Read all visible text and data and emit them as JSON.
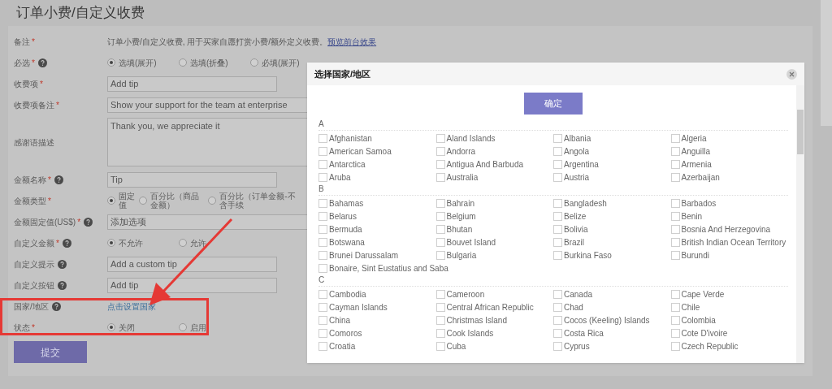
{
  "page": {
    "title": "订单小费/自定义收费"
  },
  "form": {
    "rows": [
      {
        "kind": "note",
        "label": "备注",
        "required_mark": "*",
        "help": false,
        "text": "订单小费/自定义收费, 用于买家自愿打赏小费/额外定义收费。",
        "link": "预览前台效果"
      },
      {
        "kind": "radio",
        "label": "必选",
        "required_mark": "*",
        "help": true,
        "options": [
          {
            "label": "选填(展开)",
            "selected": true
          },
          {
            "label": "选填(折叠)",
            "selected": false
          },
          {
            "label": "必填(展开)",
            "selected": false
          }
        ]
      },
      {
        "kind": "input",
        "label": "收费项",
        "required_mark": "*",
        "help": false,
        "value": "Add tip"
      },
      {
        "kind": "wide_input",
        "label": "收费项备注",
        "required_mark": "*",
        "help": false,
        "value": "Show your support for the team at enterprise"
      },
      {
        "kind": "textarea",
        "label": "感谢语描述",
        "help": false,
        "value": "Thank you, we appreciate it"
      },
      {
        "kind": "input",
        "label": "金额名称",
        "required_mark": "*",
        "help": true,
        "value": "Tip"
      },
      {
        "kind": "radio_tight",
        "label": "金额类型",
        "required_mark": "*",
        "help": false,
        "options": [
          {
            "label": "固定值",
            "selected": true
          },
          {
            "label": "百分比（商品金额）",
            "selected": false
          },
          {
            "label": "百分比（订单金额-不含手续",
            "selected": false
          }
        ]
      },
      {
        "kind": "wide_input",
        "label": "金额固定值(US$)",
        "required_mark": "*",
        "help": true,
        "value": "添加选项"
      },
      {
        "kind": "radio",
        "label": "自定义金额",
        "required_mark": "*",
        "help": true,
        "options": [
          {
            "label": "不允许",
            "selected": true
          },
          {
            "label": "允许",
            "selected": false
          }
        ]
      },
      {
        "kind": "input",
        "label": "自定义提示",
        "help": true,
        "value": "Add a custom tip"
      },
      {
        "kind": "input",
        "label": "自定义按钮",
        "help": true,
        "value": "Add tip"
      },
      {
        "kind": "link",
        "label": "国家/地区",
        "help": true,
        "link": "点击设置国家"
      },
      {
        "kind": "radio",
        "label": "状态",
        "required_mark": "*",
        "help": false,
        "options": [
          {
            "label": "关闭",
            "selected": true
          },
          {
            "label": "启用",
            "selected": false
          }
        ]
      }
    ],
    "submit": "提交"
  },
  "dialog": {
    "title": "选择国家/地区",
    "confirm": "确定",
    "sections": [
      {
        "letter": "A",
        "countries": [
          {
            "name": "Afghanistan",
            "checked": false
          },
          {
            "name": "Aland Islands",
            "checked": false
          },
          {
            "name": "Albania",
            "checked": false
          },
          {
            "name": "Algeria",
            "checked": false
          },
          {
            "name": "American Samoa",
            "checked": false
          },
          {
            "name": "Andorra",
            "checked": false
          },
          {
            "name": "Angola",
            "checked": false
          },
          {
            "name": "Anguilla",
            "checked": false
          },
          {
            "name": "Antarctica",
            "checked": false
          },
          {
            "name": "Antigua And Barbuda",
            "checked": false
          },
          {
            "name": "Argentina",
            "checked": false
          },
          {
            "name": "Armenia",
            "checked": false
          },
          {
            "name": "Aruba",
            "checked": false
          },
          {
            "name": "Australia",
            "checked": false
          },
          {
            "name": "Austria",
            "checked": false
          },
          {
            "name": "Azerbaijan",
            "checked": false
          }
        ]
      },
      {
        "letter": "B",
        "countries": [
          {
            "name": "Bahamas",
            "checked": false
          },
          {
            "name": "Bahrain",
            "checked": false
          },
          {
            "name": "Bangladesh",
            "checked": false
          },
          {
            "name": "Barbados",
            "checked": false
          },
          {
            "name": "Belarus",
            "checked": false
          },
          {
            "name": "Belgium",
            "checked": false
          },
          {
            "name": "Belize",
            "checked": false
          },
          {
            "name": "Benin",
            "checked": false
          },
          {
            "name": "Bermuda",
            "checked": false
          },
          {
            "name": "Bhutan",
            "checked": false
          },
          {
            "name": "Bolivia",
            "checked": false
          },
          {
            "name": "Bosnia And Herzegovina",
            "checked": false
          },
          {
            "name": "Botswana",
            "checked": false
          },
          {
            "name": "Bouvet Island",
            "checked": false
          },
          {
            "name": "Brazil",
            "checked": false
          },
          {
            "name": "British Indian Ocean Territory",
            "checked": false
          },
          {
            "name": "Brunei Darussalam",
            "checked": false
          },
          {
            "name": "Bulgaria",
            "checked": false
          },
          {
            "name": "Burkina Faso",
            "checked": false
          },
          {
            "name": "Burundi",
            "checked": false
          },
          {
            "name": "Bonaire, Sint Eustatius and Saba",
            "checked": false
          }
        ]
      },
      {
        "letter": "C",
        "countries": [
          {
            "name": "Cambodia",
            "checked": false
          },
          {
            "name": "Cameroon",
            "checked": false
          },
          {
            "name": "Canada",
            "checked": false
          },
          {
            "name": "Cape Verde",
            "checked": false
          },
          {
            "name": "Cayman Islands",
            "checked": false
          },
          {
            "name": "Central African Republic",
            "checked": false
          },
          {
            "name": "Chad",
            "checked": false
          },
          {
            "name": "Chile",
            "checked": false
          },
          {
            "name": "China",
            "checked": false
          },
          {
            "name": "Christmas Island",
            "checked": false
          },
          {
            "name": "Cocos (Keeling) Islands",
            "checked": false
          },
          {
            "name": "Colombia",
            "checked": false
          },
          {
            "name": "Comoros",
            "checked": false
          },
          {
            "name": "Cook Islands",
            "checked": false
          },
          {
            "name": "Costa Rica",
            "checked": false
          },
          {
            "name": "Cote D'ivoire",
            "checked": false
          },
          {
            "name": "Croatia",
            "checked": false
          },
          {
            "name": "Cuba",
            "checked": false
          },
          {
            "name": "Cyprus",
            "checked": false
          },
          {
            "name": "Czech Republic",
            "checked": false
          }
        ]
      }
    ]
  }
}
